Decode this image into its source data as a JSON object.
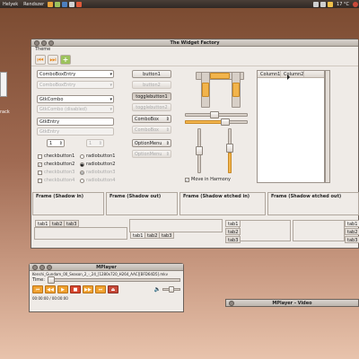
{
  "top_panel": {
    "menus": [
      "Helyek",
      "Rendszer"
    ],
    "clock": "17 °C",
    "colors": [
      "#e8a33b",
      "#9cc25d",
      "#4d7fbf",
      "#d2d2d2",
      "#e05a3a"
    ]
  },
  "desktop": {
    "icon_label": "rack"
  },
  "window": {
    "title": "The Widget Factory",
    "menu": "Theme",
    "toolbar": {
      "back_icon": "⏮",
      "forward_icon": "⏭",
      "add_icon": "+"
    },
    "column1": {
      "combo_entry": "ComboBoxEntry",
      "combo_entry_dis": "ComboBoxEntry",
      "gtk_combo": "GtkCombo",
      "gtk_combo_dis": "GtkCombo (disabled)",
      "entry": "GtkEntry",
      "entry_dis": "GtkEntry",
      "spin_value": "1",
      "spin_value_dis": "1",
      "checks": [
        {
          "label": "checkbutton1",
          "checked": false,
          "disabled": false
        },
        {
          "label": "checkbutton2",
          "checked": true,
          "disabled": false
        },
        {
          "label": "checkbutton3",
          "checked": true,
          "disabled": true
        },
        {
          "label": "checkbutton4",
          "checked": false,
          "disabled": true
        }
      ],
      "radios": [
        {
          "label": "radiobutton1",
          "checked": false,
          "disabled": false
        },
        {
          "label": "radiobutton2",
          "checked": true,
          "disabled": false
        },
        {
          "label": "radiobutton3",
          "checked": true,
          "disabled": true
        },
        {
          "label": "radiobutton4",
          "checked": false,
          "disabled": true
        }
      ]
    },
    "column2": {
      "button1": "button1",
      "button2": "button2",
      "toggle1": "togglebutton1",
      "toggle2": "togglebutton2",
      "combobox1": "ComboBox",
      "combobox2": "ComboBox",
      "option1": "OptionMenu",
      "option2": "OptionMenu"
    },
    "sliders": {
      "move_in_harmony": "Move in Harmony",
      "move_checked": true,
      "h_value": 0.45,
      "v_value": 0.55
    },
    "tree": {
      "columns": [
        "Column1",
        "Column2"
      ]
    },
    "frames": [
      "Frame (Shadow in)",
      "Frame (Shadow out)",
      "Frame (Shadow etched in)",
      "Frame (Shadow etched out)"
    ],
    "notebooks": {
      "tabs": [
        "tab1",
        "tab2",
        "tab3"
      ]
    }
  },
  "mplayer": {
    "title": "MPlayer",
    "file": "Kenshi_Gundam_00_Season_2_-_24_[1280x720_H264_AAC][BFD64D5].mkv",
    "time_label": "Time:",
    "time_current": "00:00:00",
    "time_total": "00:00:00",
    "time_display": "00:00:00  /  00:00:00",
    "buttons": [
      "⏮",
      "◀◀",
      "▶",
      "■",
      "▶▶",
      "⏭",
      "⏏"
    ],
    "volume_icon": "🔈"
  },
  "video_window": {
    "title": "MPlayer - Video"
  }
}
